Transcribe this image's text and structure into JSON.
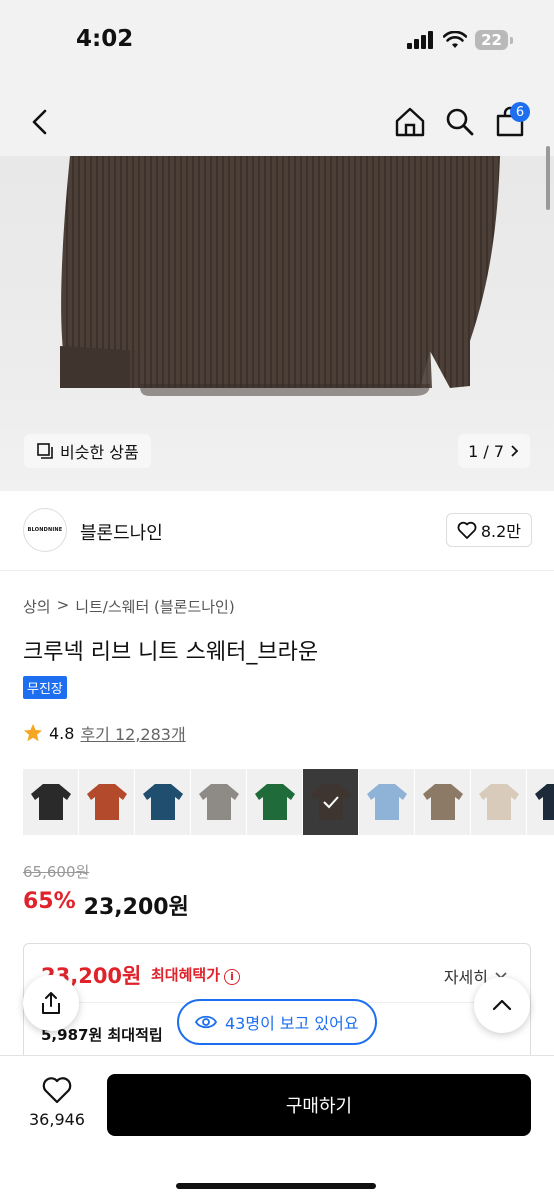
{
  "status": {
    "time": "4:02",
    "battery": "22"
  },
  "nav": {
    "cart_count": "6"
  },
  "gallery": {
    "similar_label": "비슷한 상품",
    "page": "1 / 7"
  },
  "brand": {
    "logo_text": "BLONDNINE",
    "name": "블론드나인",
    "likes": "8.2만"
  },
  "breadcrumb": {
    "cat1": "상의",
    "sep": ">",
    "cat2": "니트/스웨터 (블론드나인)"
  },
  "product": {
    "title": "크루넥 리브 니트 스웨터_브라운",
    "badge": "무진장",
    "rating": "4.8",
    "reviews": "후기 12,283개"
  },
  "swatches": [
    {
      "color": "#2a2a2a"
    },
    {
      "color": "#b44a2c"
    },
    {
      "color": "#1f4e6e"
    },
    {
      "color": "#8e8b86"
    },
    {
      "color": "#1f6b3a"
    },
    {
      "color": "#3f3530"
    },
    {
      "color": "#8fb3d6"
    },
    {
      "color": "#8c7a66"
    },
    {
      "color": "#d8cbbb"
    },
    {
      "color": "#1d2a3a"
    }
  ],
  "selected_swatch": 5,
  "price": {
    "original": "65,600원",
    "discount": "65%",
    "sale": "23,200원"
  },
  "benefit": {
    "price": "23,200원",
    "label": "최대혜택가",
    "info": "i",
    "detail": "자세히",
    "points": "5,987원 최대적립"
  },
  "viewers": "43명이 보고 있어요",
  "bottom": {
    "wish_count": "36,946",
    "buy_label": "구매하기"
  },
  "colors": {
    "accent": "#1e6ff0",
    "sale": "#e0232b"
  }
}
